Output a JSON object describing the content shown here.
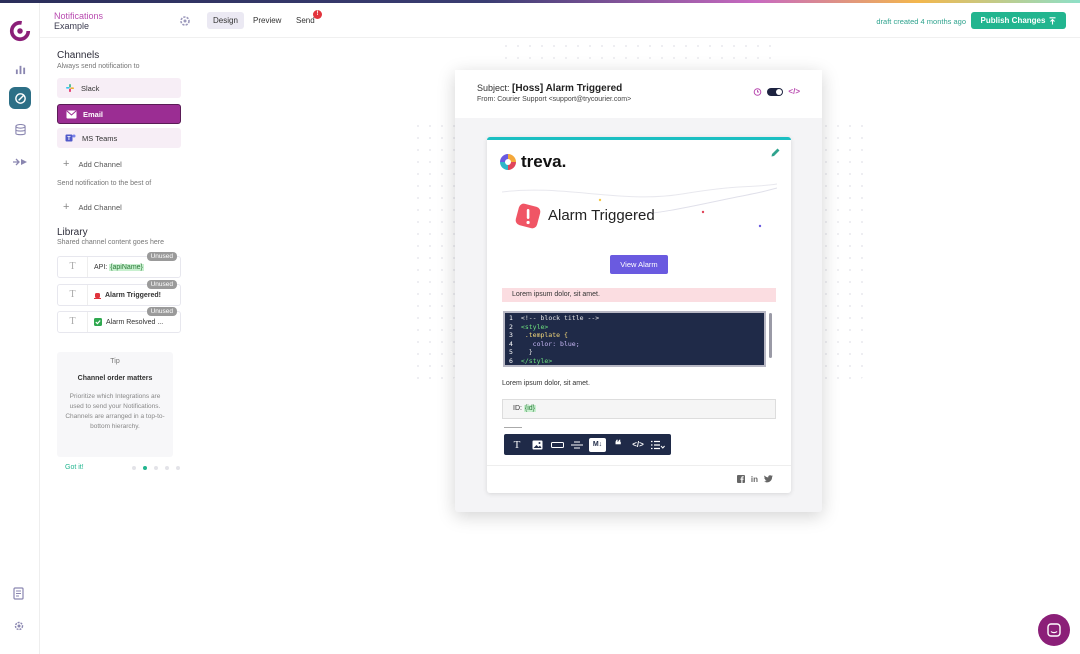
{
  "header": {
    "breadcrumb_parent": "Notifications",
    "breadcrumb_title": "Example",
    "tabs": [
      {
        "label": "Design"
      },
      {
        "label": "Preview"
      },
      {
        "label": "Send"
      }
    ],
    "send_badge": "!",
    "draft_status": "draft created 4 months ago",
    "publish_label": "Publish Changes"
  },
  "channels": {
    "title": "Channels",
    "subtitle": "Always send notification to",
    "items": [
      {
        "label": "Slack"
      },
      {
        "label": "Email"
      },
      {
        "label": "MS Teams"
      }
    ],
    "add_label": "Add Channel",
    "best_of_label": "Send notification to the best of",
    "add_label_2": "Add Channel"
  },
  "library": {
    "title": "Library",
    "subtitle": "Shared channel content goes here",
    "items": [
      {
        "prefix": "API: ",
        "highlight": "{apiName}",
        "badge": "Unused"
      },
      {
        "label": "Alarm Triggered!",
        "badge": "Unused"
      },
      {
        "label": "Alarm Resolved ...",
        "badge": "Unused"
      }
    ]
  },
  "tip": {
    "label": "Tip",
    "title": "Channel order matters",
    "body": "Prioritize which Integrations are used to send your Notifications. Channels are arranged in a top-to-bottom hierarchy.",
    "action": "Got it!"
  },
  "email": {
    "subject_prefix": "Subject:",
    "subject": "[Hoss] Alarm Triggered",
    "from": "From: Courier Support <support@trycourier.com>",
    "code_toggle": "</>",
    "brand": "treva.",
    "hero_title": "Alarm Triggered",
    "button_label": "View Alarm",
    "alert_text": "Lorem ipsum dolor, sit amet.",
    "code_lines": [
      {
        "n": "1",
        "text": "<!-- block title -->"
      },
      {
        "n": "2",
        "text": "<style>"
      },
      {
        "n": "3",
        "text": ".template {"
      },
      {
        "n": "4",
        "text": "color: blue;"
      },
      {
        "n": "5",
        "text": "}"
      },
      {
        "n": "6",
        "text": "</style>"
      }
    ],
    "paragraph": "Lorem ipsum dolor, sit amet.",
    "id_prefix": "ID: ",
    "id_value": "{id}",
    "toolbar": [
      "T",
      "image",
      "button",
      "divider",
      "M↓",
      "❝",
      "</>",
      "list"
    ],
    "social": [
      "f",
      "in",
      "twitter"
    ]
  },
  "colors": {
    "accent": "#22b58f",
    "brand_purple": "#9b2d93",
    "email_button": "#6a5ae0",
    "code_bg": "#1f2a48"
  }
}
